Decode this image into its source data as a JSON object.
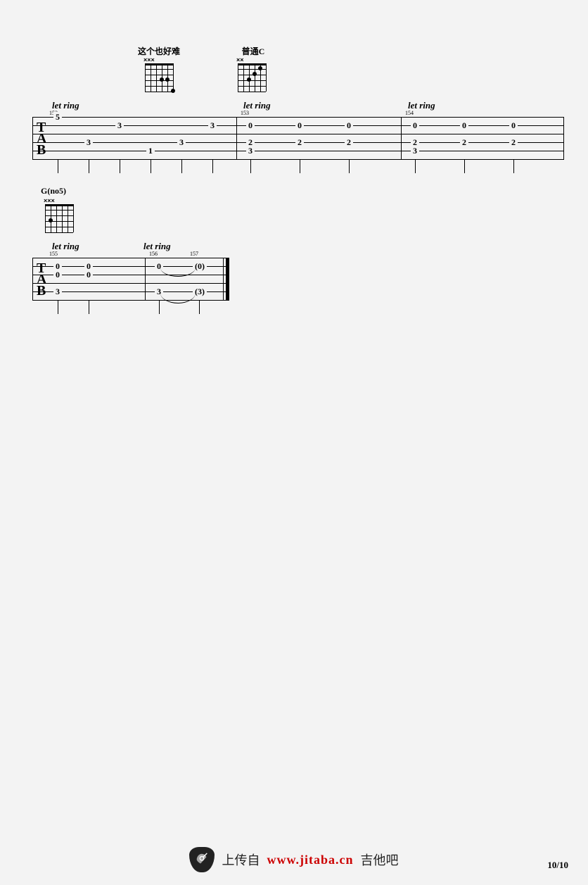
{
  "page_number": "10/10",
  "footer": {
    "upload": "上传自",
    "url": "www.jitaba.cn",
    "site": "吉他吧"
  },
  "chords": [
    {
      "label": "这个也好难",
      "muted_markers": "×××"
    },
    {
      "label": "普通C",
      "muted_markers": "××"
    },
    {
      "label": "G(no5)",
      "muted_markers": "×××"
    }
  ],
  "staff1": {
    "tab_letters": [
      "T",
      "A",
      "B"
    ],
    "bars": [
      {
        "bar_number": "152",
        "let_ring": "let ring",
        "notes": [
          {
            "string": 1,
            "fret": "5"
          },
          {
            "string": 4,
            "fret": "3"
          },
          {
            "string": 2,
            "fret": "3"
          },
          {
            "string": 5,
            "fret": "1"
          },
          {
            "string": 4,
            "fret": "3"
          },
          {
            "string": 2,
            "fret": "3"
          }
        ]
      },
      {
        "bar_number": "153",
        "let_ring": "let ring",
        "notes": [
          {
            "string": 2,
            "fret": "0"
          },
          {
            "string": 4,
            "fret": "2"
          },
          {
            "string": 5,
            "fret": "3"
          },
          {
            "string": 2,
            "fret": "0"
          },
          {
            "string": 4,
            "fret": "2"
          },
          {
            "string": 2,
            "fret": "0"
          },
          {
            "string": 4,
            "fret": "2"
          }
        ]
      },
      {
        "bar_number": "154",
        "let_ring": "let ring",
        "notes": [
          {
            "string": 2,
            "fret": "0"
          },
          {
            "string": 4,
            "fret": "2"
          },
          {
            "string": 5,
            "fret": "3"
          },
          {
            "string": 2,
            "fret": "0"
          },
          {
            "string": 4,
            "fret": "2"
          },
          {
            "string": 2,
            "fret": "0"
          },
          {
            "string": 4,
            "fret": "2"
          }
        ]
      }
    ]
  },
  "staff2": {
    "tab_letters": [
      "T",
      "A",
      "B"
    ],
    "bars": [
      {
        "bar_number": "155",
        "let_ring": "let ring",
        "notes": [
          {
            "string": 2,
            "fret": "0"
          },
          {
            "string": 3,
            "fret": "0"
          },
          {
            "string": 5,
            "fret": "3"
          },
          {
            "string": 2,
            "fret": "0"
          },
          {
            "string": 3,
            "fret": "0"
          }
        ]
      },
      {
        "bar_number": "156",
        "let_ring": "let ring",
        "notes": [
          {
            "string": 2,
            "fret": "0"
          },
          {
            "string": 5,
            "fret": "3"
          }
        ]
      },
      {
        "bar_number": "157",
        "notes": [
          {
            "string": 2,
            "fret": "(0)"
          },
          {
            "string": 5,
            "fret": "(3)"
          }
        ]
      }
    ]
  }
}
